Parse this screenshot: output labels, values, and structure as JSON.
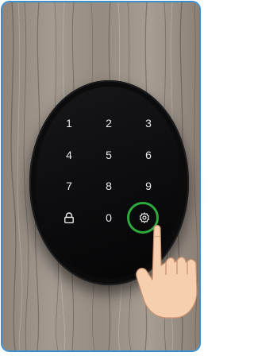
{
  "scene": {
    "border_color": "#3d8ccc",
    "highlight_color": "#2da83a",
    "background": "weathered gray wood door"
  },
  "keypad": {
    "rows": [
      [
        "1",
        "2",
        "3"
      ],
      [
        "4",
        "5",
        "6"
      ],
      [
        "7",
        "8",
        "9"
      ]
    ],
    "bottom": {
      "left_icon": "lock-icon",
      "center_label": "0",
      "right_icon": "gear-icon"
    },
    "highlighted_key": "gear-icon"
  },
  "gesture": {
    "icon": "pointing-hand-icon",
    "target": "gear-icon"
  }
}
